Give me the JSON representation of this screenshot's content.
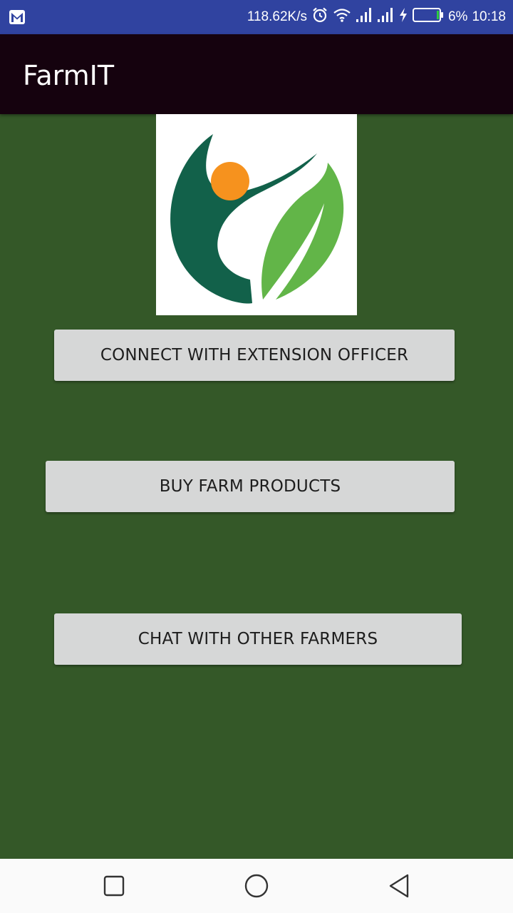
{
  "status_bar": {
    "speed": "118.62K/s",
    "battery": "6%",
    "time": "10:18",
    "icons": [
      "gmail-icon",
      "alarm-icon",
      "wifi-icon",
      "signal-icon",
      "signal-icon",
      "charging-icon",
      "battery-icon"
    ]
  },
  "app_bar": {
    "title": "FarmIT"
  },
  "buttons": {
    "connect": "CONNECT WITH EXTENSION OFFICER",
    "buy": "BUY FARM PRODUCTS",
    "chat": "CHAT WITH OTHER FARMERS"
  },
  "nav_bar": {
    "icons": [
      "recents-icon",
      "home-icon",
      "back-icon"
    ]
  },
  "colors": {
    "status_bar": "#3043a0",
    "app_bar": "#15020e",
    "background": "#345828",
    "button": "#d6d7d7",
    "logo_dark_green": "#12614a",
    "logo_light_green": "#62b548",
    "logo_orange": "#f6921e"
  }
}
